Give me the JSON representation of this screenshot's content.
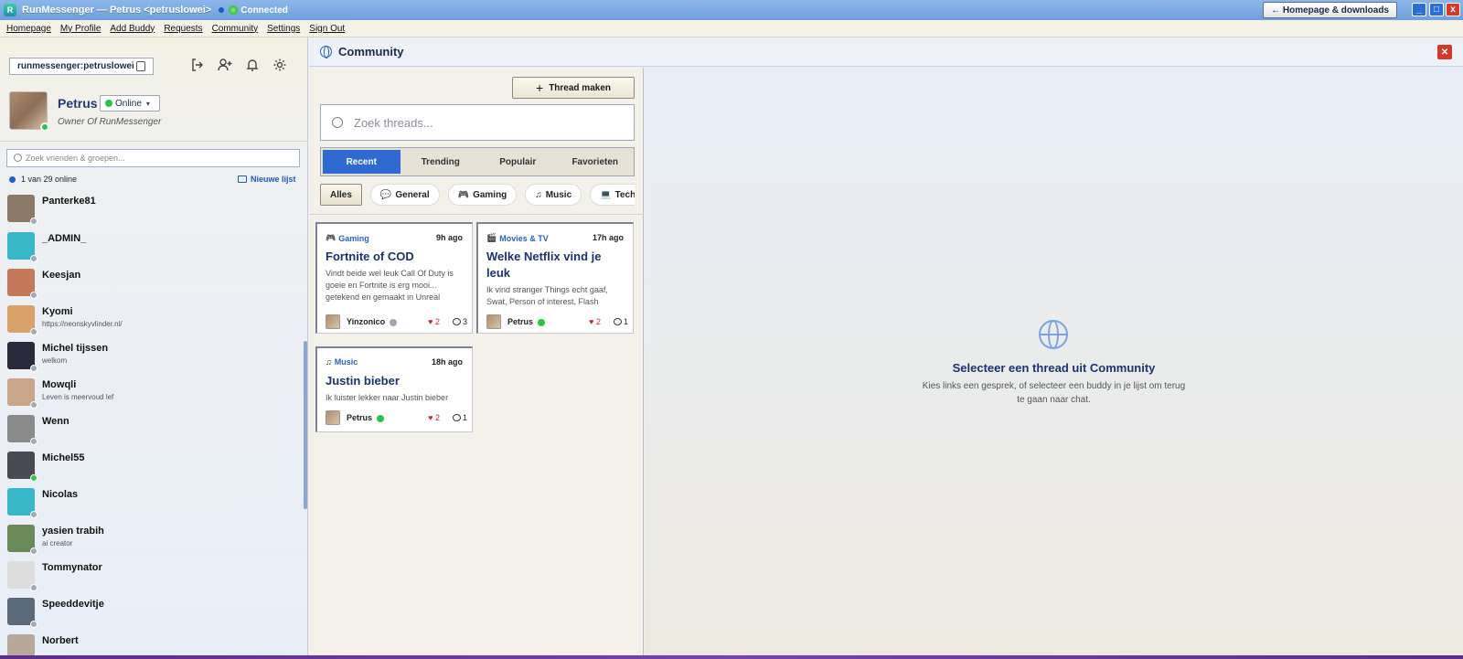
{
  "window": {
    "title": "RunMessenger — Petrus <petruslowei>",
    "connection_status": "Connected",
    "homepage_button": "← Homepage & downloads",
    "minimize": "_",
    "maximize": "□",
    "close": "x"
  },
  "menu": [
    "Homepage",
    "My Profile",
    "Add Buddy",
    "Requests",
    "Community",
    "Settings",
    "Sign Out"
  ],
  "profile": {
    "user_id": "runmessenger:petruslowei",
    "name": "Petrus",
    "status": "Online",
    "tagline": "Owner Of RunMessenger"
  },
  "friends": {
    "search_placeholder": "Zoek vrienden & groepen...",
    "online_count": "1 van 29 online",
    "new_list": "Nieuwe lijst",
    "items": [
      {
        "name": "Panterke81",
        "status": "",
        "online": false,
        "color": "#8b7a66"
      },
      {
        "name": "_ADMIN_",
        "status": "",
        "online": false,
        "color": "#3ab8c9"
      },
      {
        "name": "Keesjan",
        "status": "",
        "online": false,
        "color": "#c47a5a"
      },
      {
        "name": "Kyomi",
        "status": "https://neonskyvlinder.nl/",
        "online": false,
        "color": "#d9a26b"
      },
      {
        "name": "Michel tijssen",
        "status": "welkom",
        "online": false,
        "color": "#2a2a3a"
      },
      {
        "name": "Mowqli",
        "status": "Leven is meervoud lef",
        "online": false,
        "color": "#c9a58a"
      },
      {
        "name": "Wenn",
        "status": "",
        "online": false,
        "color": "#8a8a8a"
      },
      {
        "name": "Michel55",
        "status": "",
        "online": true,
        "color": "#4a4a52"
      },
      {
        "name": "Nicolas",
        "status": "",
        "online": false,
        "color": "#3ab8c9"
      },
      {
        "name": "yasien trabih",
        "status": "ai creator",
        "online": false,
        "color": "#6a8a5a"
      },
      {
        "name": "Tommynator",
        "status": "",
        "online": false,
        "color": "#dddddd"
      },
      {
        "name": "Speeddevitje",
        "status": "",
        "online": false,
        "color": "#5a6a7a"
      },
      {
        "name": "Norbert",
        "status": "",
        "online": false,
        "color": "#b8a89a"
      }
    ]
  },
  "community": {
    "title": "Community",
    "new_thread": "Thread maken",
    "search_placeholder": "Zoek threads...",
    "tabs": [
      "Recent",
      "Trending",
      "Populair",
      "Favorieten"
    ],
    "filters": [
      {
        "label": "Alles",
        "icon": ""
      },
      {
        "label": "General",
        "icon": "💬"
      },
      {
        "label": "Gaming",
        "icon": "🎮"
      },
      {
        "label": "Music",
        "icon": "♫"
      },
      {
        "label": "Technology",
        "icon": "💻"
      }
    ],
    "threads": [
      {
        "category": "Gaming",
        "cat_icon": "🎮",
        "ago": "9h ago",
        "title": "Fortnite of COD",
        "excerpt": "Vindt beide wel leuk Call Of Duty is goeie en Fortnite is erg mooi... getekend en gemaakt in Unreal Engine",
        "author": "Yinzonico",
        "author_online": false,
        "likes": "2",
        "comments": "3"
      },
      {
        "category": "Movies & TV",
        "cat_icon": "🎬",
        "ago": "17h ago",
        "title": "Welke Netflix vind je leuk",
        "excerpt": "Ik vind stranger Things echt gaaf, Swat, Person of interest, Flash",
        "author": "Petrus",
        "author_online": true,
        "likes": "2",
        "comments": "1"
      },
      {
        "category": "Music",
        "cat_icon": "♫",
        "ago": "18h ago",
        "title": "Justin bieber",
        "excerpt": "Ik luister lekker naar Justin bieber",
        "author": "Petrus",
        "author_online": true,
        "likes": "2",
        "comments": "1"
      }
    ],
    "empty_title": "Selecteer een thread uit Community",
    "empty_subtitle": "Kies links een gesprek, of selecteer een buddy in je lijst om terug te gaan naar chat."
  }
}
